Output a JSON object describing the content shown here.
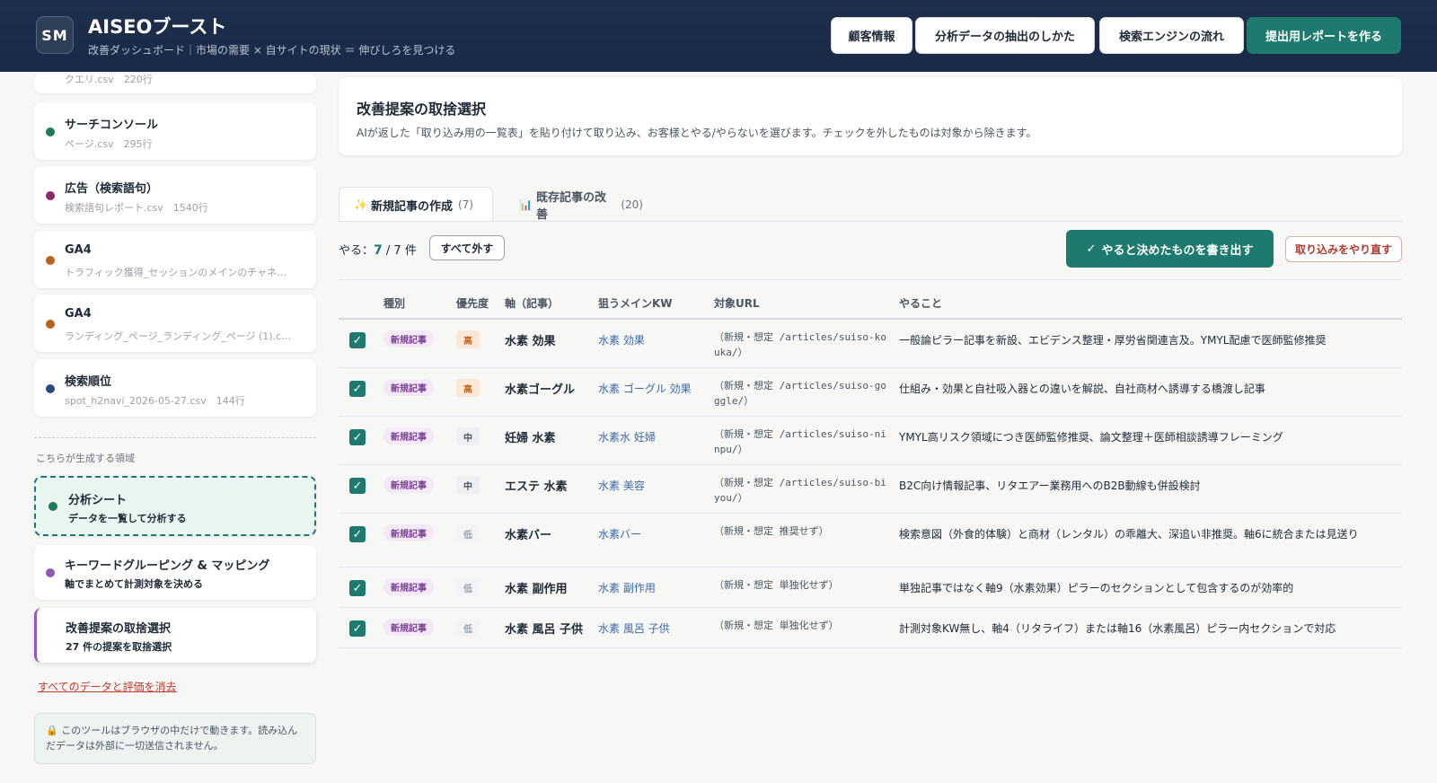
{
  "header": {
    "logo": "SM",
    "title": "AISEOブースト",
    "subtitle": "改善ダッシュボード｜市場の需要 × 自サイトの現状 ＝ 伸びしろを見つける",
    "buttons": [
      "顧客情報",
      "分析データの抽出のしかた",
      "検索エンジンの流れ",
      "提出用レポートを作る"
    ]
  },
  "sidebar": {
    "partial_top_text": "クエリ.csv　220行",
    "sources": [
      {
        "title": "サーチコンソール",
        "sub": "ページ.csv　295行",
        "color": "#1e7a5a"
      },
      {
        "title": "広告（検索語句）",
        "sub": "検索語句レポート.csv　1540行",
        "color": "#8a2a6b"
      },
      {
        "title": "GA4",
        "sub": "トラフィック獲得_セッションのメインのチャネ…",
        "color": "#b5651d"
      },
      {
        "title": "GA4",
        "sub": "ランディング_ページ_ランディング_ページ (1).c…",
        "color": "#b5651d"
      },
      {
        "title": "検索順位",
        "sub": "spot_h2navi_2026-05-27.csv　144行",
        "color": "#2a4a7a"
      }
    ],
    "section_label": "こちらが生成する領域",
    "generated": [
      {
        "title": "分析シート",
        "sub": "データを一覧して分析する",
        "color": "#1e7a5a"
      },
      {
        "title": "キーワードグルーピング & マッピング",
        "sub": "軸でまとめて計測対象を決める",
        "color": "#8e5bb5"
      },
      {
        "title": "改善提案の取捨選択",
        "sub": "27 件の提案を取捨選択",
        "color": "#8e5bb5"
      }
    ],
    "clear_link": "すべてのデータと評価を消去",
    "note": "このツールはブラウザの中だけで動きます。読み込んだデータは外部に一切送信されません。"
  },
  "main": {
    "title": "改善提案の取捨選択",
    "description": "AIが返した「取り込み用の一覧表」を貼り付けて取り込み、お客様とやる/やらないを選びます。チェックを外したものは対象から除きます。",
    "tabs": [
      {
        "icon": "✨",
        "label": "新規記事の作成",
        "count": "(7)"
      },
      {
        "icon": "📊",
        "label": "既存記事の改善",
        "count": "(20)"
      }
    ],
    "yaru_label": "やる：",
    "yaru_count": "7",
    "yaru_total": " / 7 件",
    "deselect_all": "すべて外す",
    "export_button": "やると決めたものを書き出す",
    "redo_button": "取り込みをやり直す",
    "columns": [
      "種別",
      "優先度",
      "軸（記事）",
      "狙うメインKW",
      "対象URL",
      "やること"
    ],
    "rows": [
      {
        "type": "新規記事",
        "priority": "高",
        "axis": "水素 効果",
        "kw": "水素 効果",
        "url": "（新規・想定 /articles/suiso-kouka/）",
        "todo": "一般論ピラー記事を新設、エビデンス整理・厚労省関連言及。YMYL配慮で医師監修推奨"
      },
      {
        "type": "新規記事",
        "priority": "高",
        "axis": "水素ゴーグル",
        "kw": "水素 ゴーグル 効果",
        "url": "（新規・想定 /articles/suiso-goggle/）",
        "todo": "仕組み・効果と自社吸入器との違いを解説、自社商材へ誘導する橋渡し記事"
      },
      {
        "type": "新規記事",
        "priority": "中",
        "axis": "妊婦 水素",
        "kw": "水素水 妊婦",
        "url": "（新規・想定 /articles/suiso-ninpu/）",
        "todo": "YMYL高リスク領域につき医師監修推奨、論文整理＋医師相談誘導フレーミング"
      },
      {
        "type": "新規記事",
        "priority": "中",
        "axis": "エステ 水素",
        "kw": "水素 美容",
        "url": "（新規・想定 /articles/suiso-biyou/）",
        "todo": "B2C向け情報記事、リタエアー業務用へのB2B動線も併設検討"
      },
      {
        "type": "新規記事",
        "priority": "低",
        "axis": "水素バー",
        "kw": "水素バー",
        "url": "（新規・想定 推奨せず）",
        "todo": "検索意図（外食的体験）と商材（レンタル）の乖離大、深追い非推奨。軸6に統合または見送り"
      },
      {
        "type": "新規記事",
        "priority": "低",
        "axis": "水素 副作用",
        "kw": "水素 副作用",
        "url": "（新規・想定 単独化せず）",
        "todo": "単独記事ではなく軸9（水素効果）ピラーのセクションとして包含するのが効率的"
      },
      {
        "type": "新規記事",
        "priority": "低",
        "axis": "水素 風呂 子供",
        "kw": "水素 風呂 子供",
        "url": "（新規・想定 単独化せず）",
        "todo": "計測対象KW無し、軸4（リタライフ）または軸16（水素風呂）ピラー内セクションで対応"
      }
    ]
  },
  "colors": {
    "accent": "#1e7a6e",
    "header_bg": "#1e2f4d",
    "priority_high_bg": "#fde8d6",
    "priority_high_fg": "#c0661f",
    "priority_mid_bg": "#eef0f3",
    "priority_low_bg": "#f3f4f6"
  }
}
